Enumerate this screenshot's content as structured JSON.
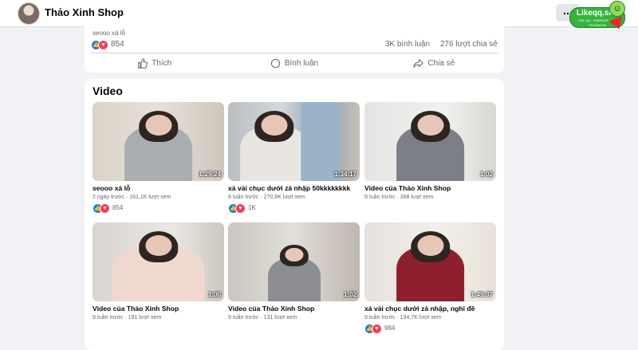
{
  "header": {
    "page_name": "Thảo Xinh Shop",
    "more_label": "...",
    "badge": {
      "site": "Likeqq.site",
      "sub": "LIKE QQ - FANPAGE, LIKE FACEBOOK"
    }
  },
  "post": {
    "caption": "seooo xả lỗ",
    "reaction_count": "854",
    "comments": "3K bình luận",
    "shares": "276 lượt chia sẻ",
    "actions": {
      "like": "Thích",
      "comment": "Bình luận",
      "share": "Chia sẻ"
    }
  },
  "video_section": {
    "heading": "Video",
    "items": [
      {
        "title": "seooo xả lỗ",
        "meta": "2 ngày trước · 161,1K lượt xem",
        "duration": "1:29:24",
        "reactions": "854",
        "has_reactions": true
      },
      {
        "title": "xả vải chục dưới zá nhập 50kkkkkkkk",
        "meta": "8 tuần trước · 270,8K lượt xem",
        "duration": "1:34:17",
        "reactions": "1K",
        "has_reactions": true
      },
      {
        "title": "Video của Thảo Xinh Shop",
        "meta": "9 tuần trước · 388 lượt xem",
        "duration": "1:02",
        "reactions": "",
        "has_reactions": false
      },
      {
        "title": "Video của Thảo Xinh Shop",
        "meta": "9 tuần trước · 191 lượt xem",
        "duration": "1:00",
        "reactions": "",
        "has_reactions": false
      },
      {
        "title": "Video của Thảo Xinh Shop",
        "meta": "9 tuần trước · 131 lượt xem",
        "duration": "1:02",
        "reactions": "",
        "has_reactions": false
      },
      {
        "title": "xả vải chục dưới zá nhập, nghỉ đề",
        "meta": "9 tuần trước · 194,7K lượt xem",
        "duration": "1:49:37",
        "reactions": "984",
        "has_reactions": true
      }
    ]
  },
  "colors": {
    "accent": "#1877f2",
    "love": "#f33e58",
    "badge_green": "#34b43a"
  }
}
